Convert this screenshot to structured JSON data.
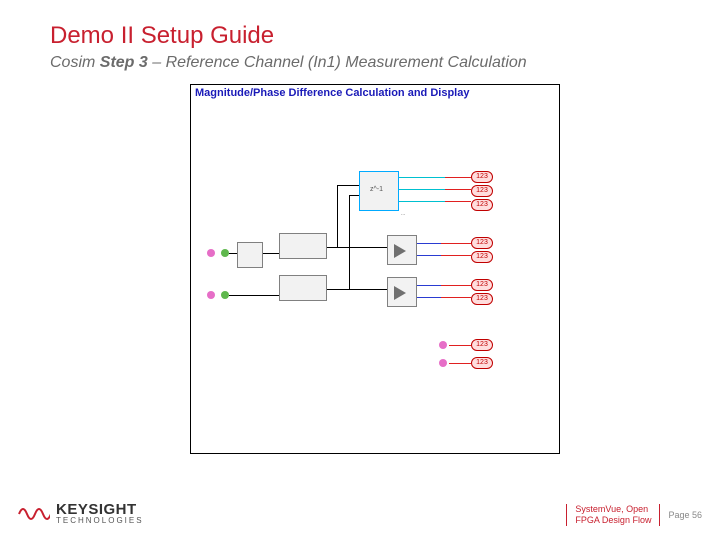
{
  "title": "Demo II Setup Guide",
  "subtitle_prefix": "Cosim ",
  "subtitle_step": "Step 3",
  "subtitle_rest": " – Reference Channel (In1) Measurement Calculation",
  "diagram": {
    "title": "Magnitude/Phase Difference Calculation and Display",
    "badge": "123",
    "sqlabel": "z^-1"
  },
  "footer": {
    "line1": "SystemVue, Open",
    "line2": "FPGA Design Flow",
    "page_label": "Page ",
    "page_num": "56"
  },
  "brand": {
    "name": "KEYSIGHT",
    "sub": "TECHNOLOGIES"
  }
}
